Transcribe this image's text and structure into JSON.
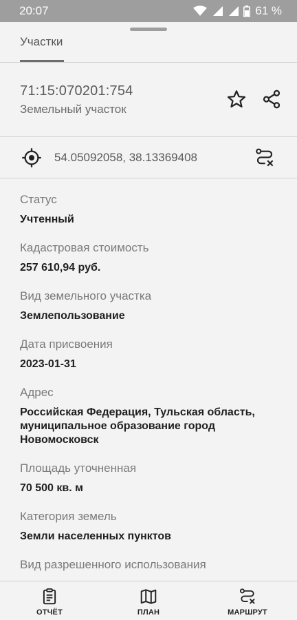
{
  "status_bar": {
    "time": "20:07",
    "battery": "61 %",
    "icons": [
      "wifi-icon",
      "signal-icon",
      "signal-icon",
      "battery-icon"
    ]
  },
  "tabs": [
    {
      "label": "Участки",
      "active": true
    }
  ],
  "parcel": {
    "cadastral_number": "71:15:070201:754",
    "type": "Земельный участок"
  },
  "location": {
    "coordinates": "54.05092058, 38.13369408"
  },
  "fields": [
    {
      "label": "Статус",
      "value": "Учтенный"
    },
    {
      "label": "Кадастровая стоимость",
      "value": "257 610,94 руб."
    },
    {
      "label": "Вид земельного участка",
      "value": "Землепользование"
    },
    {
      "label": "Дата присвоения",
      "value": "2023-01-31"
    },
    {
      "label": "Адрес",
      "value": "Российская Федерация, Тульская область, муниципальное образование город Новомосковск"
    },
    {
      "label": "Площадь уточненная",
      "value": "70 500 кв. м"
    },
    {
      "label": "Категория земель",
      "value": "Земли населенных пунктов"
    },
    {
      "label": "Вид разрешенного использования",
      "value": ""
    }
  ],
  "bottom_nav": {
    "report": "ОТЧЁТ",
    "plan": "ПЛАН",
    "route": "МАРШРУТ"
  },
  "colors": {
    "background": "#f3f3f3",
    "status_bar": "#9e9e9e",
    "divider": "#d2d2d2",
    "label": "#7a7a7a",
    "value": "#1f1f1f"
  }
}
